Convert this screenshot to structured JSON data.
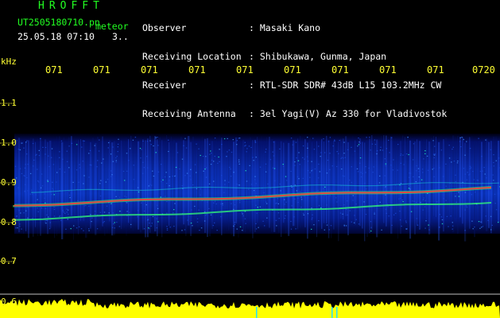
{
  "app": {
    "title": "HROFFT"
  },
  "file": {
    "name": "UT2505180710.pn",
    "label": "meteor",
    "datetime": "25.05.18 07:10",
    "count": "3.."
  },
  "info": {
    "labels": [
      "Observer",
      "Receiving Location",
      "Receiver",
      "Receiving Antenna"
    ],
    "values": [
      ": Masaki Kano",
      ": Shibukawa, Gunma, Japan",
      ": RTL-SDR SDR# 43dB L15 103.2MHz CW",
      ": 3el Yagi(V) Az 330 for Vladivostok"
    ]
  },
  "axis": {
    "unit": "kHz",
    "yticks": [
      "1.1",
      "1.0",
      "0.9",
      "0.8",
      "0.7",
      "0.6"
    ],
    "xticks": [
      "071",
      "071",
      "071",
      "071",
      "071",
      "071",
      "071",
      "071",
      "071",
      "0720"
    ]
  },
  "colors": {
    "text_green": "#22ff22",
    "text_white": "#ffffff",
    "tick_yellow": "#ffff33",
    "signal_band": "#ff3333",
    "level_bar": "#ffff00",
    "background": "#000000"
  }
}
